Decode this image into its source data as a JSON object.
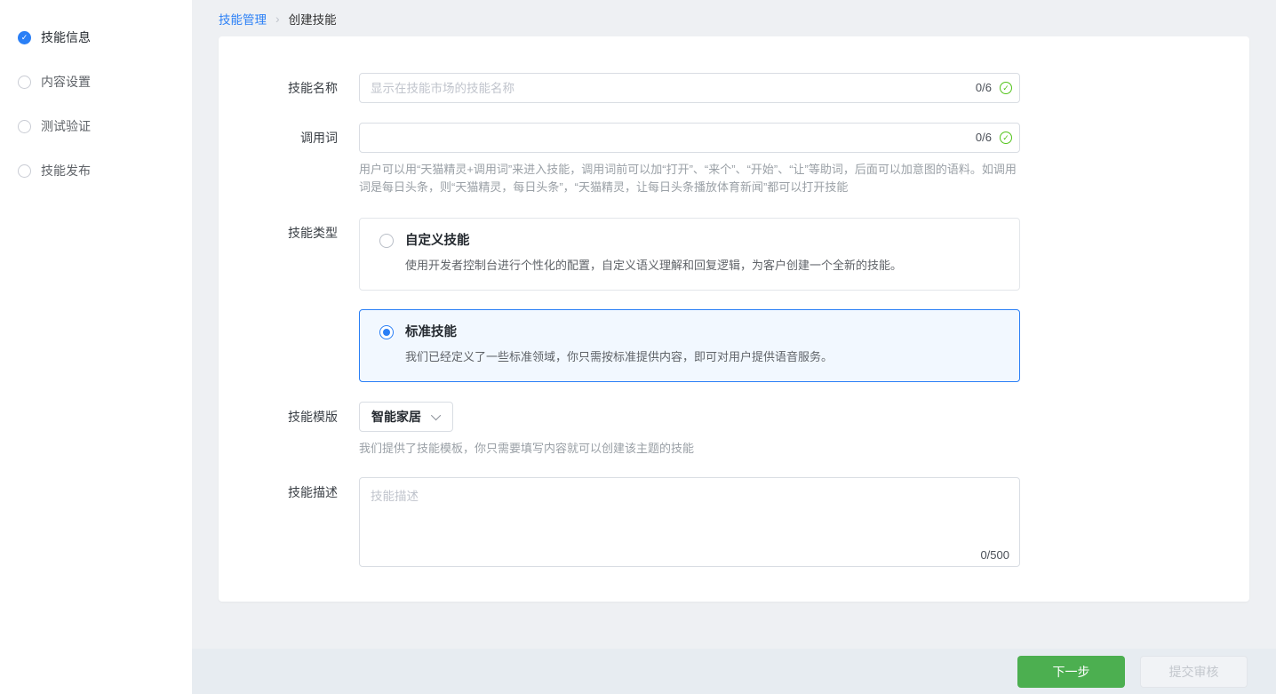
{
  "sidebar": {
    "items": [
      {
        "label": "技能信息",
        "state": "active"
      },
      {
        "label": "内容设置",
        "state": "pending"
      },
      {
        "label": "测试验证",
        "state": "pending"
      },
      {
        "label": "技能发布",
        "state": "pending"
      }
    ]
  },
  "breadcrumb": {
    "parent": "技能管理",
    "separator": "›",
    "current": "创建技能"
  },
  "form": {
    "skill_name": {
      "label": "技能名称",
      "placeholder": "显示在技能市场的技能名称",
      "value": "",
      "counter": "0/6"
    },
    "invoke_word": {
      "label": "调用词",
      "placeholder": "",
      "value": "",
      "counter": "0/6",
      "help": "用户可以用“天猫精灵+调用词”来进入技能，调用词前可以加“打开”、“来个”、“开始”、“让”等助词，后面可以加意图的语料。如调用词是每日头条，则“天猫精灵，每日头条”，“天猫精灵，让每日头条播放体育新闻”都可以打开技能"
    },
    "skill_type": {
      "label": "技能类型",
      "options": [
        {
          "title": "自定义技能",
          "desc": "使用开发者控制台进行个性化的配置，自定义语义理解和回复逻辑，为客户创建一个全新的技能。",
          "selected": false
        },
        {
          "title": "标准技能",
          "desc": "我们已经定义了一些标准领域，你只需按标准提供内容，即可对用户提供语音服务。",
          "selected": true
        }
      ]
    },
    "skill_template": {
      "label": "技能模版",
      "value": "智能家居",
      "help": "我们提供了技能模板，你只需要填写内容就可以创建该主题的技能"
    },
    "skill_desc": {
      "label": "技能描述",
      "placeholder": "技能描述",
      "value": "",
      "counter": "0/500"
    }
  },
  "footer": {
    "next_label": "下一步",
    "submit_label": "提交审核"
  },
  "icons": {
    "step_done": "check-circle",
    "step_pending": "circle-outline",
    "input_valid": "check-circle-outline",
    "select_arrow": "chevron-down"
  },
  "colors": {
    "accent_blue": "#2a7ff6",
    "success_green": "#52c41a",
    "button_green": "#4caf50",
    "page_bg": "#eef0f3",
    "footer_bg": "#e7ecf1",
    "selected_card_bg": "#f2f8ff"
  }
}
